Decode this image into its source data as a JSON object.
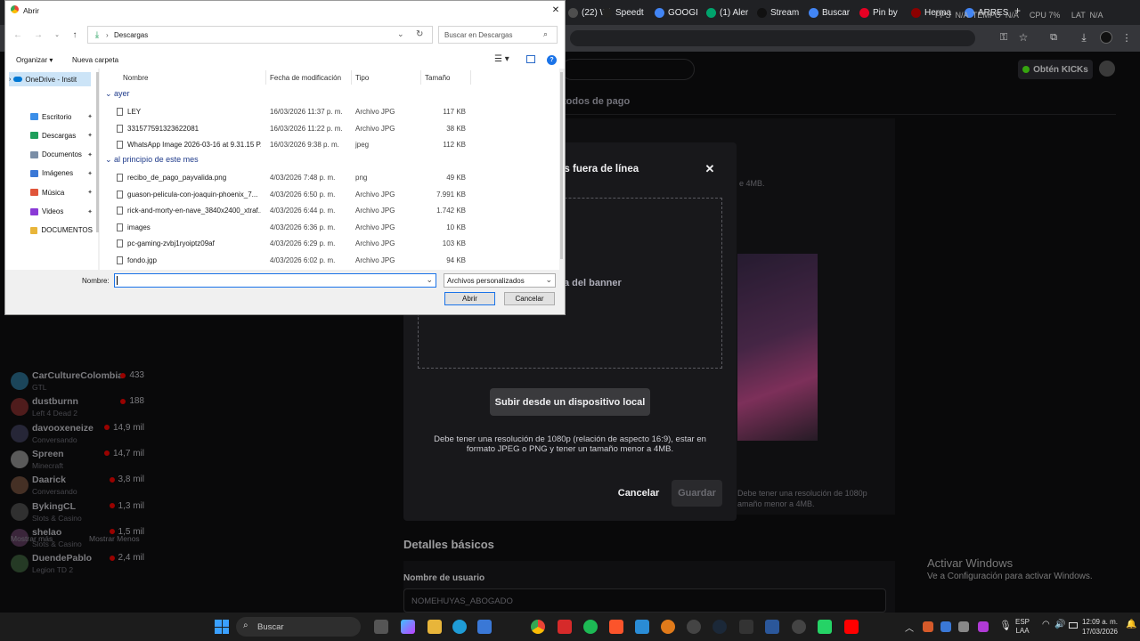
{
  "chrome": {
    "tabs": [
      {
        "label": "(22) Wi",
        "color": "#4e4e4e"
      },
      {
        "label": "Speedt",
        "color": "#222"
      },
      {
        "label": "GOOGI",
        "color": "#4285f4"
      },
      {
        "label": "(1) Aler",
        "color": "#00a36c"
      },
      {
        "label": "Stream",
        "color": "#111"
      },
      {
        "label": "Buscar",
        "color": "#4285f4"
      },
      {
        "label": "Pin by",
        "color": "#e60023"
      },
      {
        "label": "Herma",
        "color": "#8b0000"
      },
      {
        "label": "ARRES",
        "color": "#4285f4"
      }
    ],
    "overlay_stats": "FPS  N/A  TEMPO  N/A     CPU 7%     LAT  N/A"
  },
  "twitch": {
    "kicks_label": "Obtén KICKs",
    "payment_methods": "todos de pago",
    "banner_hint": "e 4MB.",
    "right_hint": "Debe tener una resolución de 1080p\namaño menor a 4MB.",
    "sidebar": [
      {
        "name": "CarCultureColombia",
        "game": "GTL",
        "viewers": "433",
        "color": "#2a6b8a"
      },
      {
        "name": "dustburnn",
        "game": "Left 4 Dead 2",
        "viewers": "188",
        "color": "#7a2b2b"
      },
      {
        "name": "davooxeneize",
        "game": "Conversando",
        "viewers": "14,9 mil",
        "color": "#3b3b55"
      },
      {
        "name": "Spreen",
        "game": "Minecraft",
        "viewers": "14,7 mil",
        "color": "#8a8a8a"
      },
      {
        "name": "Daarick",
        "game": "Conversando",
        "viewers": "3,8 mil",
        "color": "#6b4a3a"
      },
      {
        "name": "BykingCL",
        "game": "Slots & Casino",
        "viewers": "1,3 mil",
        "color": "#4a4a4a"
      },
      {
        "name": "shelao",
        "game": "Slots & Casino",
        "viewers": "1,5 mil",
        "color": "#5a3a5a"
      },
      {
        "name": "DuendePablo",
        "game": "Legion TD 2",
        "viewers": "2,4 mil",
        "color": "#3a5a3a"
      }
    ],
    "show_more": "Mostrar más",
    "show_less": "Mostrar Menos",
    "basic_details": "Detalles básicos",
    "username_label": "Nombre de usuario",
    "username_value": "NOMEHUYAS_ABOGADO",
    "modal": {
      "title": "ès fuera de línea",
      "upload_hint": "a del banner",
      "upload_button": "Subir desde un dispositivo local",
      "requirements": "Debe tener una resolución de 1080p (relación de aspecto 16:9), estar en formato JPEG o PNG y tener un tamaño menor a 4MB.",
      "cancel": "Cancelar",
      "save": "Guardar"
    },
    "activate_title": "Activar Windows",
    "activate_sub": "Ve a Configuración para activar Windows."
  },
  "dialog": {
    "title": "Abrir",
    "breadcrumb": "Descargas",
    "search_placeholder": "Buscar en Descargas",
    "organize": "Organizar",
    "new_folder": "Nueva carpeta",
    "columns": {
      "name": "Nombre",
      "date": "Fecha de modificación",
      "type": "Tipo",
      "size": "Tamaño"
    },
    "nav": {
      "onedrive": "OneDrive - Instit",
      "items": [
        {
          "label": "Escritorio",
          "color": "#3b8ee8"
        },
        {
          "label": "Descargas",
          "color": "#1e9e5a"
        },
        {
          "label": "Documentos",
          "color": "#7a8ea6"
        },
        {
          "label": "Imágenes",
          "color": "#3a78d6"
        },
        {
          "label": "Música",
          "color": "#e0553a"
        },
        {
          "label": "Videos",
          "color": "#8a3ad6"
        },
        {
          "label": "DOCUMENTOS",
          "color": "#e8b53a"
        }
      ]
    },
    "group_yesterday": "ayer",
    "group_month": "al principio de este mes",
    "files_yesterday": [
      {
        "name": "LEY",
        "date": "16/03/2026 11:37 p. m.",
        "type": "Archivo JPG",
        "size": "117 KB"
      },
      {
        "name": "331577591323622081",
        "date": "16/03/2026 11:22 p. m.",
        "type": "Archivo JPG",
        "size": "38 KB"
      },
      {
        "name": "WhatsApp Image 2026-03-16 at 9.31.15 P...",
        "date": "16/03/2026 9:38 p. m.",
        "type": "jpeg",
        "size": "112 KB"
      }
    ],
    "files_month": [
      {
        "name": "recibo_de_pago_payvalida.png",
        "date": "4/03/2026 7:48 p. m.",
        "type": "png",
        "size": "49 KB"
      },
      {
        "name": "guason-pelicula-con-joaquin-phoenix_7...",
        "date": "4/03/2026 6:50 p. m.",
        "type": "Archivo JPG",
        "size": "7.991 KB"
      },
      {
        "name": "rick-and-morty-en-nave_3840x2400_xtraf...",
        "date": "4/03/2026 6:44 p. m.",
        "type": "Archivo JPG",
        "size": "1.742 KB"
      },
      {
        "name": "images",
        "date": "4/03/2026 6:36 p. m.",
        "type": "Archivo JPG",
        "size": "10 KB"
      },
      {
        "name": "pc-gaming-zvbj1ryoiptz09af",
        "date": "4/03/2026 6:29 p. m.",
        "type": "Archivo JPG",
        "size": "103 KB"
      },
      {
        "name": "fondo.jgp",
        "date": "4/03/2026 6:02 p. m.",
        "type": "Archivo JPG",
        "size": "94 KB"
      }
    ],
    "filename_label": "Nombre:",
    "filename_value": "",
    "filter": "Archivos personalizados",
    "open": "Abrir",
    "cancel": "Cancelar"
  },
  "taskbar": {
    "search": "Buscar",
    "lang1": "ESP",
    "lang2": "LAA",
    "time": "12:09 a. m.",
    "date": "17/03/2026"
  }
}
